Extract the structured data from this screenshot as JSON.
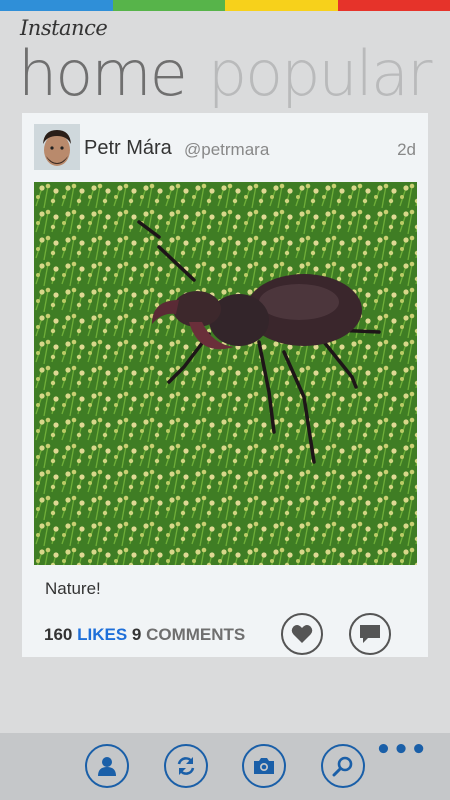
{
  "accent_colors": [
    "#2f8fd8",
    "#57b44a",
    "#f7d11b",
    "#e6332a"
  ],
  "app": {
    "title": "Instance"
  },
  "pivot": {
    "tabs": [
      "home",
      "popular"
    ],
    "active": "home"
  },
  "post": {
    "user_name": "Petr Mára",
    "handle": "@petrmara",
    "age": "2d",
    "caption": "Nature!",
    "likes_count": "160",
    "likes_label": "LIKES",
    "comments_count": "9",
    "comments_label": "COMMENTS"
  },
  "app_bar": {
    "buttons": [
      "profile-icon",
      "refresh-icon",
      "camera-icon",
      "search-icon"
    ],
    "more": "•••"
  }
}
